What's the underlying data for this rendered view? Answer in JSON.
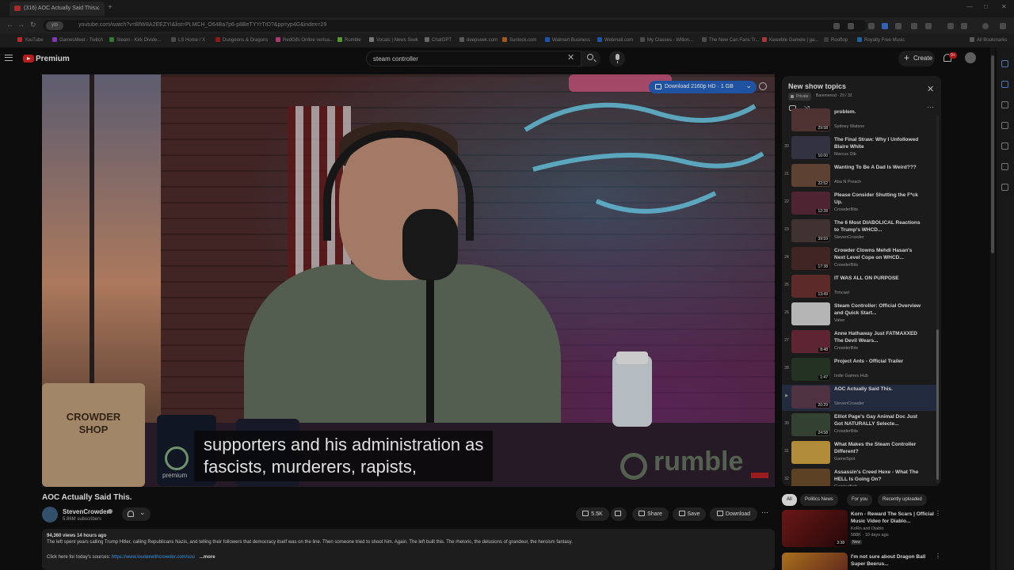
{
  "browser": {
    "tab_title": "(316) AOC Actually Said This...",
    "url": "youtube.com/watch?v=BfW8A2EEZYI&list=PLMCH_O64Ba7p6-p8BeTYYrTrD?&pp=yp4G&index=29",
    "site_chip": "ytb",
    "bookmarks": [
      "YouTube",
      "GamesMeet - Twitch",
      "Steam - Kirk Divide...",
      "LS Home / X",
      "Dungeons & Dragons",
      "RedGifs Online vertua...",
      "Rumble",
      "Vocals | News Seek",
      "ChatGPT",
      "deepseek.com",
      "Sunlock.com",
      "Walmart Business",
      "Webmail.com",
      "My Classes - Wilton...",
      "The New Can Fans Tr...",
      "Kweeble Gamele | ga...",
      "Rooftop",
      "Royalty Free Music"
    ],
    "all_bookmarks": "All Bookmarks"
  },
  "masthead": {
    "brand": "Premium",
    "search_value": "steam controller",
    "create_label": "Create",
    "notif_count": "9+"
  },
  "player": {
    "download_label": "Download 2160p HD · 1 GB",
    "caption_line1": "supporters and his administration as",
    "caption_line2": "fascists, murderers, rapists,",
    "watermark": "rumble",
    "shop_sign": "CROWDER SHOP",
    "premium_label": "premium"
  },
  "video": {
    "title": "AOC Actually Said This.",
    "channel": "StevenCrowder",
    "subscribers": "5.86M subscribers",
    "likes": "5.5K",
    "share_label": "Share",
    "save_label": "Save",
    "download_label": "Download",
    "meta": "94,360 views  14 hours ago",
    "description": "The left spent years calling Trump Hitler, calling Republicans Nazis, and telling their followers that democracy itself was on the line. Then someone tried to shoot him. Again. The left built this. The rhetoric, the delusions of grandeur, the heroism fantasy.",
    "sources_prefix": "Click here for today's sources: ",
    "sources_link": "https://www.louderwithcrowder.com/sou",
    "more_label": "...more"
  },
  "playlist": {
    "title": "New show topics",
    "private_label": "Private",
    "owner": "Baremenod · 29 / 32",
    "items": [
      {
        "idx": "",
        "title": "problem.",
        "channel": "Sydney Watson",
        "duration": "29:58",
        "color": "#5a3a3a"
      },
      {
        "idx": "20",
        "title": "The Final Straw: Why I Unfollowed Blaire White",
        "channel": "Marcus Dib",
        "duration": "16:00",
        "color": "#3a3a4a"
      },
      {
        "idx": "21",
        "title": "Wanting To Be A Dad Is Weird???",
        "channel": "Aba N Preach",
        "duration": "22:52",
        "color": "#6a4a3a"
      },
      {
        "idx": "22",
        "title": "Please Consider Shutting the F*ck Up.",
        "channel": "CrowderBits",
        "duration": "12:28",
        "color": "#5a2a3a"
      },
      {
        "idx": "23",
        "title": "The 6 Most DIABOLICAL Reactions to Trump's WHCD...",
        "channel": "StevenCrowder",
        "duration": "39:59",
        "color": "#4a3a3a"
      },
      {
        "idx": "24",
        "title": "Crowder Clowns Mehdi Hasan's Next Level Cope on WHCD...",
        "channel": "CrowderBits",
        "duration": "17:38",
        "color": "#4a2a2a"
      },
      {
        "idx": "25",
        "title": "IT WAS ALL ON PURPOSE",
        "channel": "Timcast",
        "duration": "13:49",
        "color": "#6a3030"
      },
      {
        "idx": "26",
        "title": "Steam Controller: Official Overview and Quick Start...",
        "channel": "Valve",
        "duration": "",
        "color": "#cfcfcf"
      },
      {
        "idx": "27",
        "title": "Anne Hathaway Just FATMAXXED The Devil Wears...",
        "channel": "CrowderBits",
        "duration": "8:48",
        "color": "#6a2a3a"
      },
      {
        "idx": "28",
        "title": "Project Ants - Official Trailer",
        "channel": "Indie Games Hub",
        "duration": "1:47",
        "color": "#2a3a2a"
      },
      {
        "idx": "▶",
        "title": "AOC Actually Said This.",
        "channel": "StevenCrowder",
        "duration": "20:29",
        "color": "#5a3a4a"
      },
      {
        "idx": "30",
        "title": "Elliot Page's Gay Animal Doc Just Got NATURALLY Selecte...",
        "channel": "CrowderBits",
        "duration": "24:58",
        "color": "#3a4a3a"
      },
      {
        "idx": "31",
        "title": "What Makes the Steam Controller Different?",
        "channel": "GameSpot",
        "duration": "",
        "color": "#caa040"
      },
      {
        "idx": "32",
        "title": "Assassin's Creed Hexe - What The HELL Is Going On?",
        "channel": "GamingBolt",
        "duration": "",
        "color": "#6a4a2a"
      }
    ]
  },
  "chips": [
    "All",
    "Politics News",
    "For you",
    "Recently uploaded"
  ],
  "recommendations": [
    {
      "title": "Korn - Reward The Scars | Official Music Video for Diablo...",
      "channel": "KoRn  and Diablo",
      "views": "588K · 10 days ago",
      "badge": "New",
      "duration": "3:38"
    },
    {
      "title": "I'm not sure about Dragon Ball Super Beerus...",
      "channel": "",
      "views": "",
      "badge": "",
      "duration": ""
    }
  ]
}
